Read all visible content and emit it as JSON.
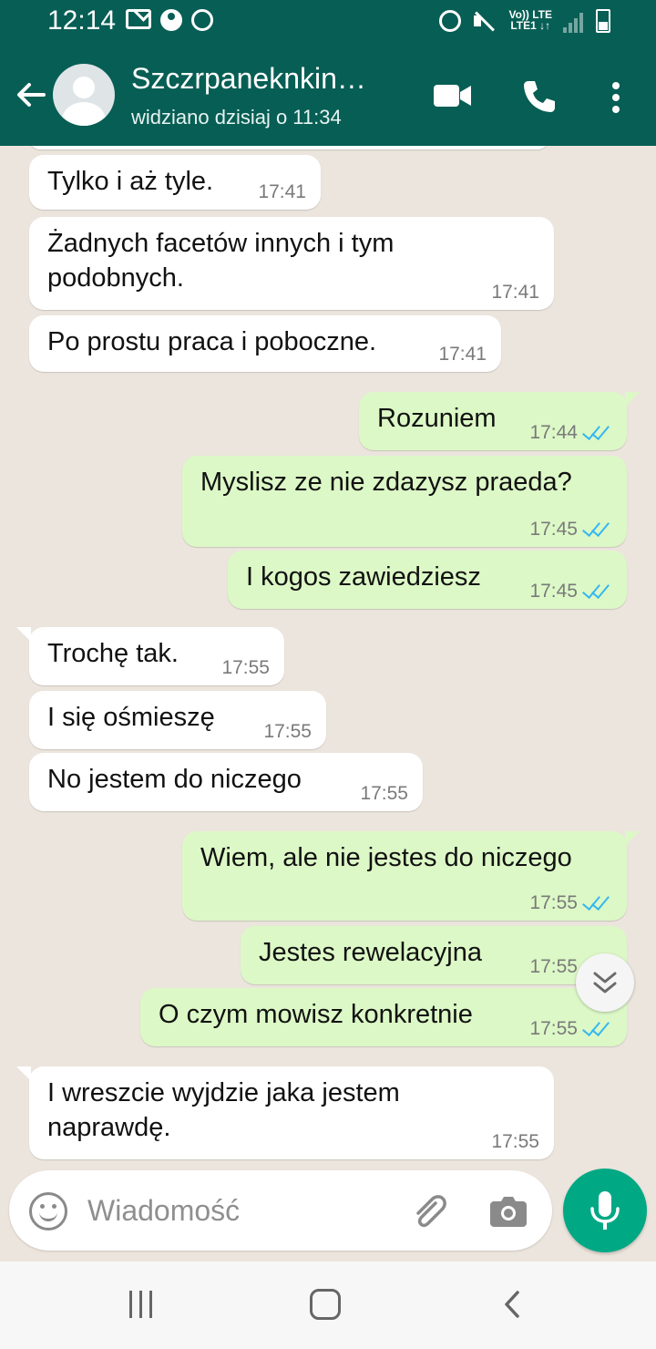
{
  "status_bar": {
    "time": "12:14",
    "lte_label_top": "Vo)) LTE",
    "lte_label_bottom": "LTE1 ↓↑"
  },
  "header": {
    "contact_name": "Szczrpaneknkin…",
    "last_seen": "widziano dzisiaj o 11:34",
    "icons": [
      "back-arrow-icon",
      "avatar",
      "video-call-icon",
      "phone-icon",
      "more-vert-icon"
    ]
  },
  "messages": [
    {
      "direction": "in",
      "text": "Tylko i aż tyle.",
      "time": "17:41"
    },
    {
      "direction": "in",
      "text": "Żadnych facetów innych i tym",
      "text2": "podobnych.",
      "time": "17:41"
    },
    {
      "direction": "in",
      "text": "Po prostu praca i poboczne.",
      "time": "17:41"
    },
    {
      "direction": "out",
      "text": "Rozuniem",
      "time": "17:44",
      "read": true
    },
    {
      "direction": "out",
      "text": "Myslisz ze nie zdazysz praeda?",
      "time": "17:45",
      "read": true
    },
    {
      "direction": "out",
      "text": "I kogos zawiedziesz",
      "time": "17:45",
      "read": true
    },
    {
      "direction": "in",
      "text": "Trochę tak.",
      "time": "17:55"
    },
    {
      "direction": "in",
      "text": "I się ośmieszę",
      "time": "17:55"
    },
    {
      "direction": "in",
      "text": "No jestem do niczego",
      "time": "17:55"
    },
    {
      "direction": "out",
      "text": "Wiem, ale nie jestes do niczego",
      "time": "17:55",
      "read": true
    },
    {
      "direction": "out",
      "text": "Jestes rewelacyjna",
      "time": "17:55",
      "read": true
    },
    {
      "direction": "out",
      "text": "O czym mowisz konkretnie",
      "time": "17:55",
      "read": true
    },
    {
      "direction": "in",
      "text": "I wreszcie wyjdzie jaka jestem",
      "text2": "naprawdę.",
      "time": "17:55"
    }
  ],
  "composer": {
    "placeholder": "Wiadomość",
    "value": ""
  },
  "colors": {
    "header": "#075e54",
    "incoming_bubble": "#ffffff",
    "outgoing_bubble": "#dcf8c6",
    "mic_button": "#00a884",
    "read_ticks": "#34b7f1",
    "chat_background": "#ece5dd"
  }
}
